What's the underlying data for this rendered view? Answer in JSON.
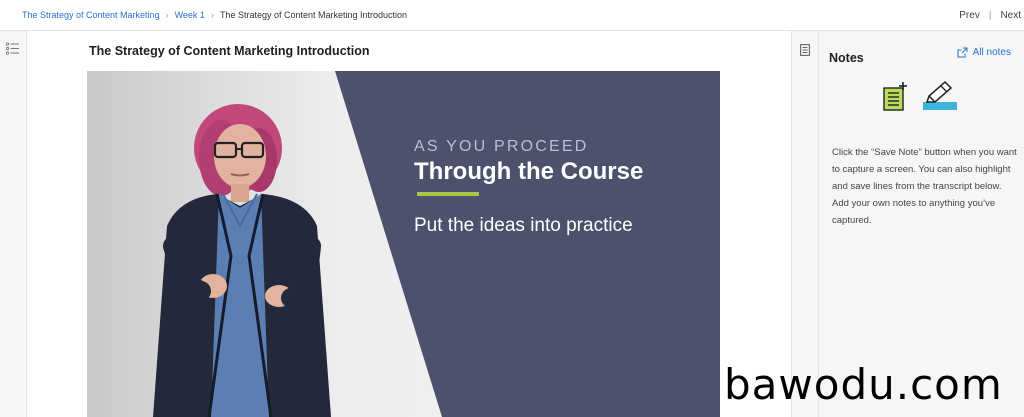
{
  "breadcrumb": {
    "course": "The Strategy of Content Marketing",
    "week": "Week 1",
    "current": "The Strategy of Content Marketing Introduction",
    "separator": "›"
  },
  "pager": {
    "prev": "Prev",
    "divider": "|",
    "next": "Next"
  },
  "lesson": {
    "title": "The Strategy of Content Marketing Introduction"
  },
  "video": {
    "kicker": "AS YOU PROCEED",
    "heading": "Through the Course",
    "subheading": "Put the ideas into practice",
    "panel_color": "#4d516b",
    "accent_color": "#a8c64a"
  },
  "notes": {
    "title": "Notes",
    "all_notes_link": "All notes",
    "help_text": "Click the “Save Note” button when you want to capture a screen. You can also highlight and save lines from the transcript below. Add your own notes to anything you’ve captured.",
    "icons": [
      "save-note-icon",
      "highlight-icon"
    ]
  },
  "icons": {
    "left_rail": "outline-icon",
    "right_rail": "transcript-icon",
    "all_notes": "external-link-icon"
  },
  "watermark": "bawodu.com",
  "colors": {
    "link": "#2a73cc",
    "rail_bg": "#f6f6f6",
    "highlight": "#3fb3d9"
  }
}
